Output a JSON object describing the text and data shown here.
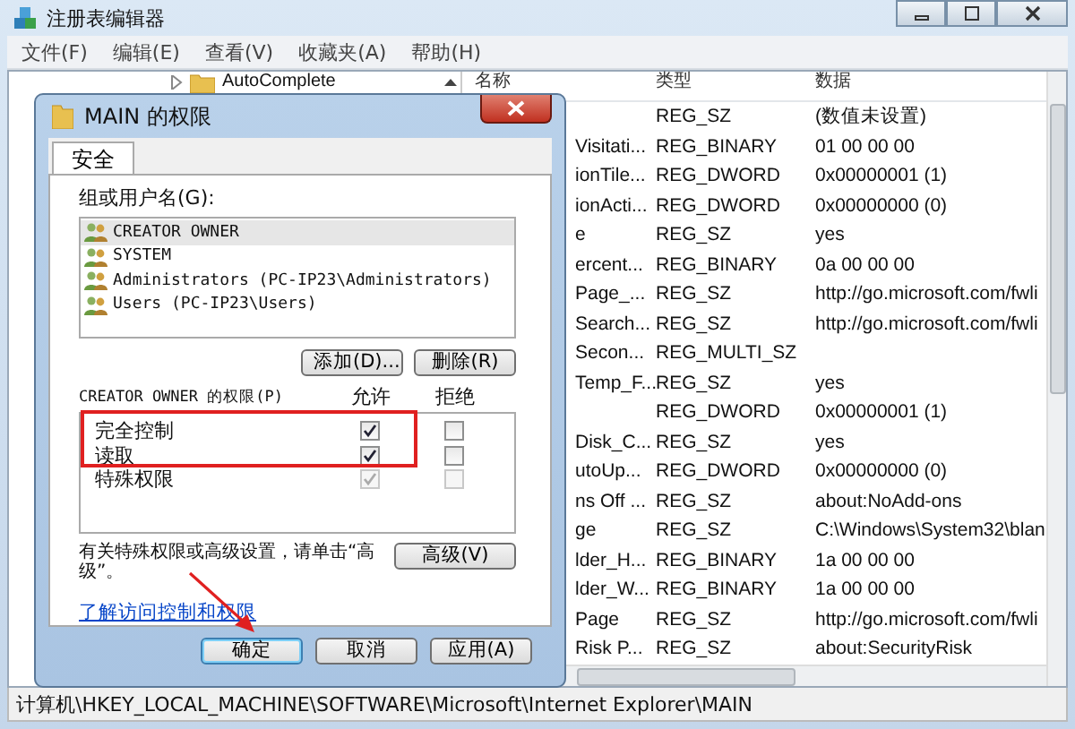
{
  "window": {
    "title": "注册表编辑器"
  },
  "menu": [
    "文件(F)",
    "编辑(E)",
    "查看(V)",
    "收藏夹(A)",
    "帮助(H)"
  ],
  "tree": {
    "items": [
      {
        "label": "AutoComplete",
        "expanded": false
      }
    ]
  },
  "values": {
    "columns": [
      "名称",
      "类型",
      "数据"
    ],
    "rows": [
      {
        "type": "REG_SZ",
        "data": "(数值未设置)"
      },
      {
        "name": "Visitati...",
        "type": "REG_BINARY",
        "data": "01 00 00 00"
      },
      {
        "name": "ionTile...",
        "type": "REG_DWORD",
        "data": "0x00000001 (1)"
      },
      {
        "name": "ionActi...",
        "type": "REG_DWORD",
        "data": "0x00000000 (0)"
      },
      {
        "name": "e",
        "type": "REG_SZ",
        "data": "yes"
      },
      {
        "name": "ercent...",
        "type": "REG_BINARY",
        "data": "0a 00 00 00"
      },
      {
        "name": "Page_...",
        "type": "REG_SZ",
        "data": "http://go.microsoft.com/fwli"
      },
      {
        "name": "Search...",
        "type": "REG_SZ",
        "data": "http://go.microsoft.com/fwli"
      },
      {
        "name": "Secon...",
        "type": "REG_MULTI_SZ"
      },
      {
        "name": "Temp_F...",
        "type": "REG_SZ",
        "data": "yes"
      },
      {
        "type": "REG_DWORD",
        "data": "0x00000001 (1)"
      },
      {
        "name": "Disk_C...",
        "type": "REG_SZ",
        "data": "yes"
      },
      {
        "name": "utoUp...",
        "type": "REG_DWORD",
        "data": "0x00000000 (0)"
      },
      {
        "name": "ns Off ...",
        "type": "REG_SZ",
        "data": "about:NoAdd-ons"
      },
      {
        "name": "ge",
        "type": "REG_SZ",
        "data": "C:\\Windows\\System32\\blan"
      },
      {
        "name": "lder_H...",
        "type": "REG_BINARY",
        "data": "1a 00 00 00"
      },
      {
        "name": "lder_W...",
        "type": "REG_BINARY",
        "data": "1a 00 00 00"
      },
      {
        "name": "Page",
        "type": "REG_SZ",
        "data": "http://go.microsoft.com/fwli"
      },
      {
        "name": "Risk P...",
        "type": "REG_SZ",
        "data": "about:SecurityRisk"
      }
    ]
  },
  "status_bar": "计算机\\HKEY_LOCAL_MACHINE\\SOFTWARE\\Microsoft\\Internet Explorer\\MAIN",
  "dialog": {
    "title": "MAIN 的权限",
    "tabs": [
      {
        "label": "安全",
        "selected": true
      }
    ],
    "group_label": "组或用户名(G):",
    "users": [
      {
        "name": "CREATOR OWNER",
        "selected": true
      },
      {
        "name": "SYSTEM",
        "selected": false
      },
      {
        "name": "Administrators (PC-IP23\\Administrators)",
        "selected": false
      },
      {
        "name": "Users (PC-IP23\\Users)",
        "selected": false
      }
    ],
    "add_button": "添加(D)...",
    "remove_button": "删除(R)",
    "permissions_label": "CREATOR OWNER 的权限(P)",
    "allow_header": "允许",
    "deny_header": "拒绝",
    "permissions": [
      {
        "name": "完全控制",
        "allow": {
          "checked": true,
          "disabled": false
        },
        "deny": {
          "checked": false,
          "disabled": false
        }
      },
      {
        "name": "读取",
        "allow": {
          "checked": true,
          "disabled": false
        },
        "deny": {
          "checked": false,
          "disabled": false
        }
      },
      {
        "name": "特殊权限",
        "allow": {
          "checked": true,
          "disabled": true
        },
        "deny": {
          "checked": false,
          "disabled": true
        }
      }
    ],
    "advanced_text": "有关特殊权限或高级设置，请单击“高级”。",
    "advanced_button": "高级(V)",
    "link": "了解访问控制和权限",
    "buttons": [
      {
        "label": "确定",
        "default": true
      },
      {
        "label": "取消",
        "default": false
      },
      {
        "label": "应用(A)",
        "default": false
      }
    ]
  }
}
